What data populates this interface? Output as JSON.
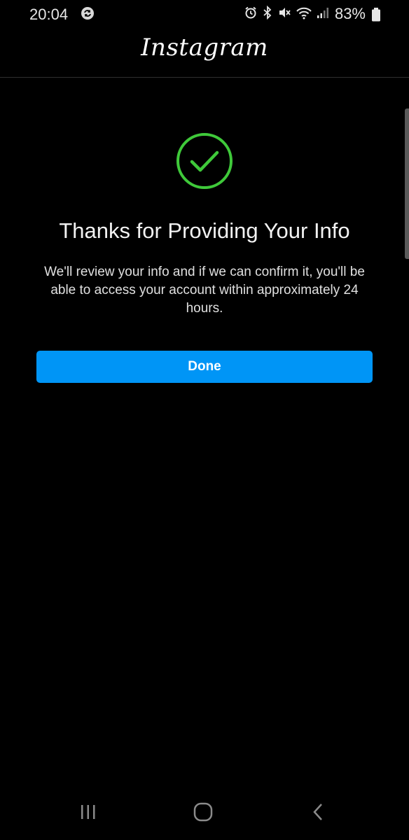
{
  "status_bar": {
    "time": "20:04",
    "battery_percent": "83%",
    "icons": [
      "sync-icon",
      "alarm-icon",
      "bluetooth-icon",
      "mute-icon",
      "wifi-icon",
      "signal-icon",
      "battery-icon"
    ]
  },
  "header": {
    "logo_text": "Instagram"
  },
  "confirmation": {
    "icon": "check-circle-icon",
    "accent_color": "#3fc93a",
    "title": "Thanks for Providing Your Info",
    "message": "We'll review your info and if we can confirm it, you'll be able to access your account within approximately 24 hours.",
    "done_label": "Done",
    "button_color": "#0095f6"
  },
  "nav_bar": {
    "icons": [
      "recent-apps-icon",
      "home-icon",
      "back-icon"
    ]
  }
}
